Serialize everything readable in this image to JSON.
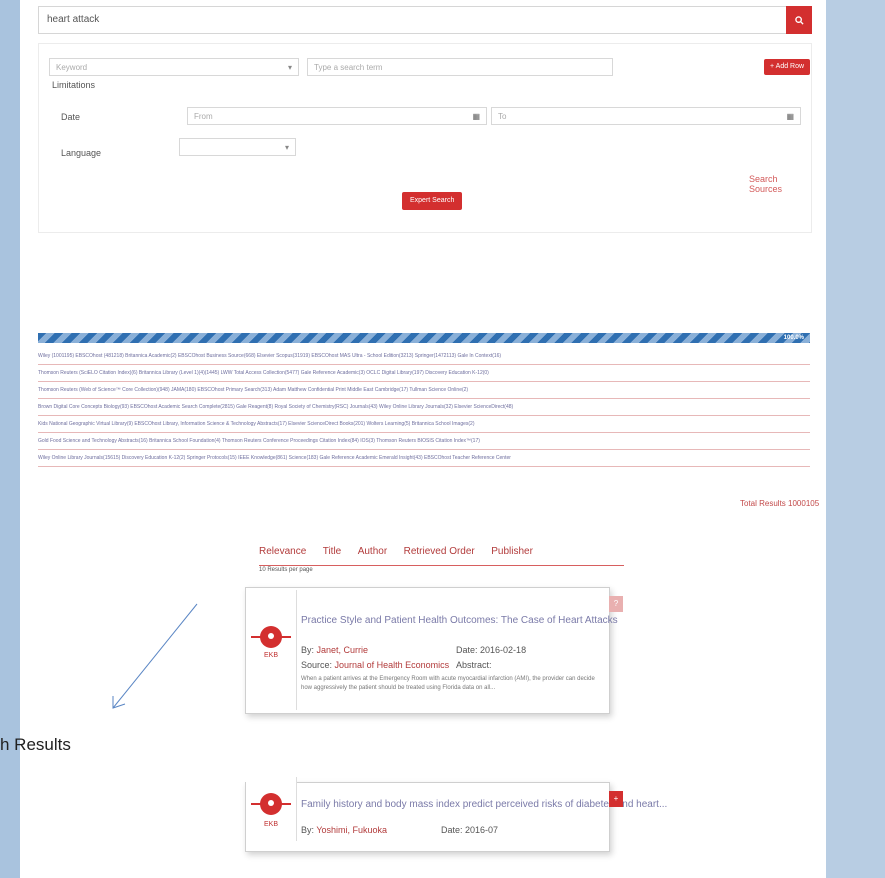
{
  "search": {
    "value": "heart attack",
    "button_icon": "search-icon"
  },
  "advanced": {
    "field_select": "Keyword",
    "search_term_placeholder": "Type a search term",
    "add_filter": "+ Add Row",
    "limitations_label": "Limitations",
    "date_label": "Date",
    "date_from_placeholder": "From",
    "date_to_placeholder": "To",
    "language_label": "Language",
    "language_value": "",
    "search_sources": "Search Sources",
    "expert_search": "Expert Search"
  },
  "progress": {
    "label": "100.0%",
    "value": 1.0
  },
  "sources": [
    "Wiley (1001195)  EBSCOhost (481218)  Britannica Academic(2)  EBSCOhost Business Source(668)  Elsevier Scopus(31919)  EBSCOhost MAS Ultra - School Edition(3213)  Springer(1472113)  Gale In Context(16)",
    "Thomson Reuters (SciELO Citation Index)(6)  Britannica Library (Level 1)(4)(1445)  LWW Total Access Collection(5477)  Gale Reference Academic(3)  OCLC Digital Library(197)  Discovery Education K-12(0)",
    "Thomson Reuters (Web of Science™ Core Collection)(948)  JAMA(180)  EBSCOhost Primary Search(313)  Adam Matthew Confidential Print Middle East  Cambridge(17)  Tullman Science Online(2)",
    "Brown Digital Core Concepts Biology(93)  EBSCOhost Academic Search Complete(2815)  Gale Reagent(8)  Royal Society of Chemistry(RSC) Journals(43)  Wiley Online Library Journals(32)  Elsevier ScienceDirect(48)",
    "Kids National Geographic Virtual Library(9)  EBSCOhost Library, Information Science & Technology Abstracts(17)  Elsevier ScienceDirect Books(201)  Wolters Learning(5)  Britannica School Images(2)",
    "Gold Food Science and Technology Abstracts(16)  Britannica School Foundation(4)  Thomson Reuters Conference Proceedings Citation Index(84)  IOS(3)  Thomson Reuters BIOSIS Citation Index™(17)",
    "Wiley Online Library Journals(15615)  Discovery Education K-12(2)  Springer Protocols(15)  IEEE Knowledge(861)  Science(183)  Gale Reference Academic  Emerald Insight(43)  EBSCOhost Teacher Reference Center"
  ],
  "total_results": "Total Results  1000105",
  "sort": {
    "options": [
      "Relevance",
      "Title",
      "Author",
      "Retrieved Order",
      "Publisher"
    ],
    "per_page": "10 Results per page"
  },
  "results": [
    {
      "thumb_label": "EKB",
      "title": "Practice Style and Patient Health Outcomes: The Case of Heart Attacks",
      "by_label": "By:",
      "author": "Janet, Currie",
      "date_label": "Date:",
      "date": "2016-02-18",
      "source_label": "Source:",
      "source": "Journal of Health Economics",
      "abstract_label": "Abstract:",
      "abstract": "When a patient arrives at the Emergency Room with acute myocardial infarction (AMI), the provider can decide how aggressively the patient should be treated using Florida data on all...",
      "side_icon": "?"
    },
    {
      "thumb_label": "EKB",
      "title": "Family history and body mass index predict perceived risks of diabetes and heart...",
      "by_label": "By:",
      "author": "Yoshimi, Fukuoka",
      "date_label": "Date:",
      "date": "2016-07",
      "side_icon": "+"
    }
  ],
  "annotation": {
    "caption": "h Results"
  },
  "colors": {
    "accent": "#d32f2f",
    "link": "#7a7aa8",
    "progress": "#2f6fb1",
    "page_bg": "#a9c3de"
  }
}
